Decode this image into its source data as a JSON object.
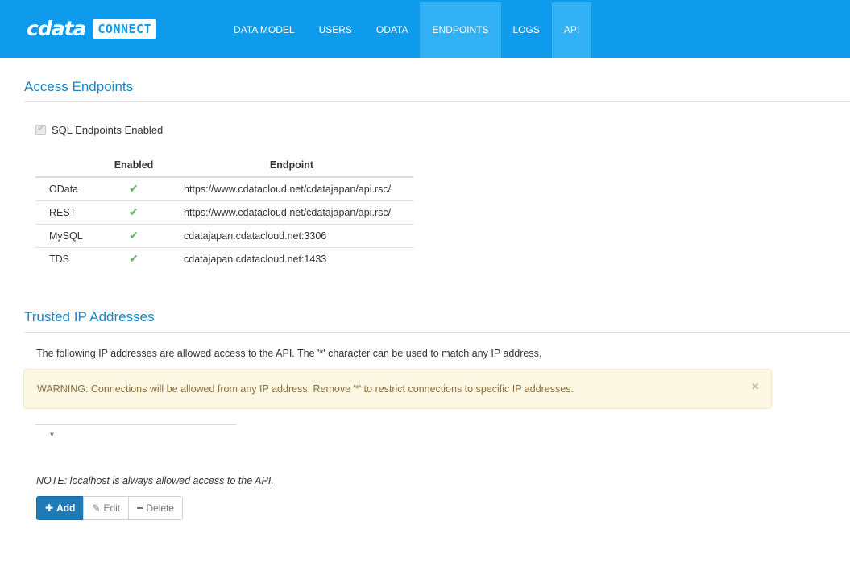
{
  "header": {
    "brand_name": "cdata",
    "brand_badge": "CONNECT",
    "nav": [
      {
        "label": "DATA MODEL",
        "active": false
      },
      {
        "label": "USERS",
        "active": false
      },
      {
        "label": "ODATA",
        "active": false
      },
      {
        "label": "ENDPOINTS",
        "active": true
      },
      {
        "label": "LOGS",
        "active": false
      },
      {
        "label": "API",
        "active": true
      }
    ]
  },
  "access_endpoints": {
    "title": "Access Endpoints",
    "sql_enabled_label": "SQL Endpoints Enabled",
    "sql_enabled_checked": true,
    "columns": {
      "enabled": "Enabled",
      "endpoint": "Endpoint"
    },
    "rows": [
      {
        "name": "OData",
        "enabled": true,
        "endpoint": "https://www.cdatacloud.net/cdatajapan/api.rsc/"
      },
      {
        "name": "REST",
        "enabled": true,
        "endpoint": "https://www.cdatacloud.net/cdatajapan/api.rsc/"
      },
      {
        "name": "MySQL",
        "enabled": true,
        "endpoint": "cdatajapan.cdatacloud.net:3306"
      },
      {
        "name": "TDS",
        "enabled": true,
        "endpoint": "cdatajapan.cdatacloud.net:1433"
      }
    ]
  },
  "trusted_ips": {
    "title": "Trusted IP Addresses",
    "description": "The following IP addresses are allowed access to the API. The '*' character can be used to match any IP address.",
    "warning": "WARNING: Connections will be allowed from any IP address. Remove '*' to restrict connections to specific IP addresses.",
    "warning_close": "×",
    "ip_list": [
      "*"
    ],
    "note": "NOTE: localhost is always allowed access to the API.",
    "buttons": {
      "add": "Add",
      "edit": "Edit",
      "delete": "Delete"
    }
  },
  "colors": {
    "header_bg": "#0f9bec",
    "nav_active_bg": "#33b1f5",
    "title_blue": "#1a86c7",
    "check_green": "#5cb85c",
    "warning_bg": "#fcf8e3",
    "primary_button": "#1f7ab8"
  }
}
